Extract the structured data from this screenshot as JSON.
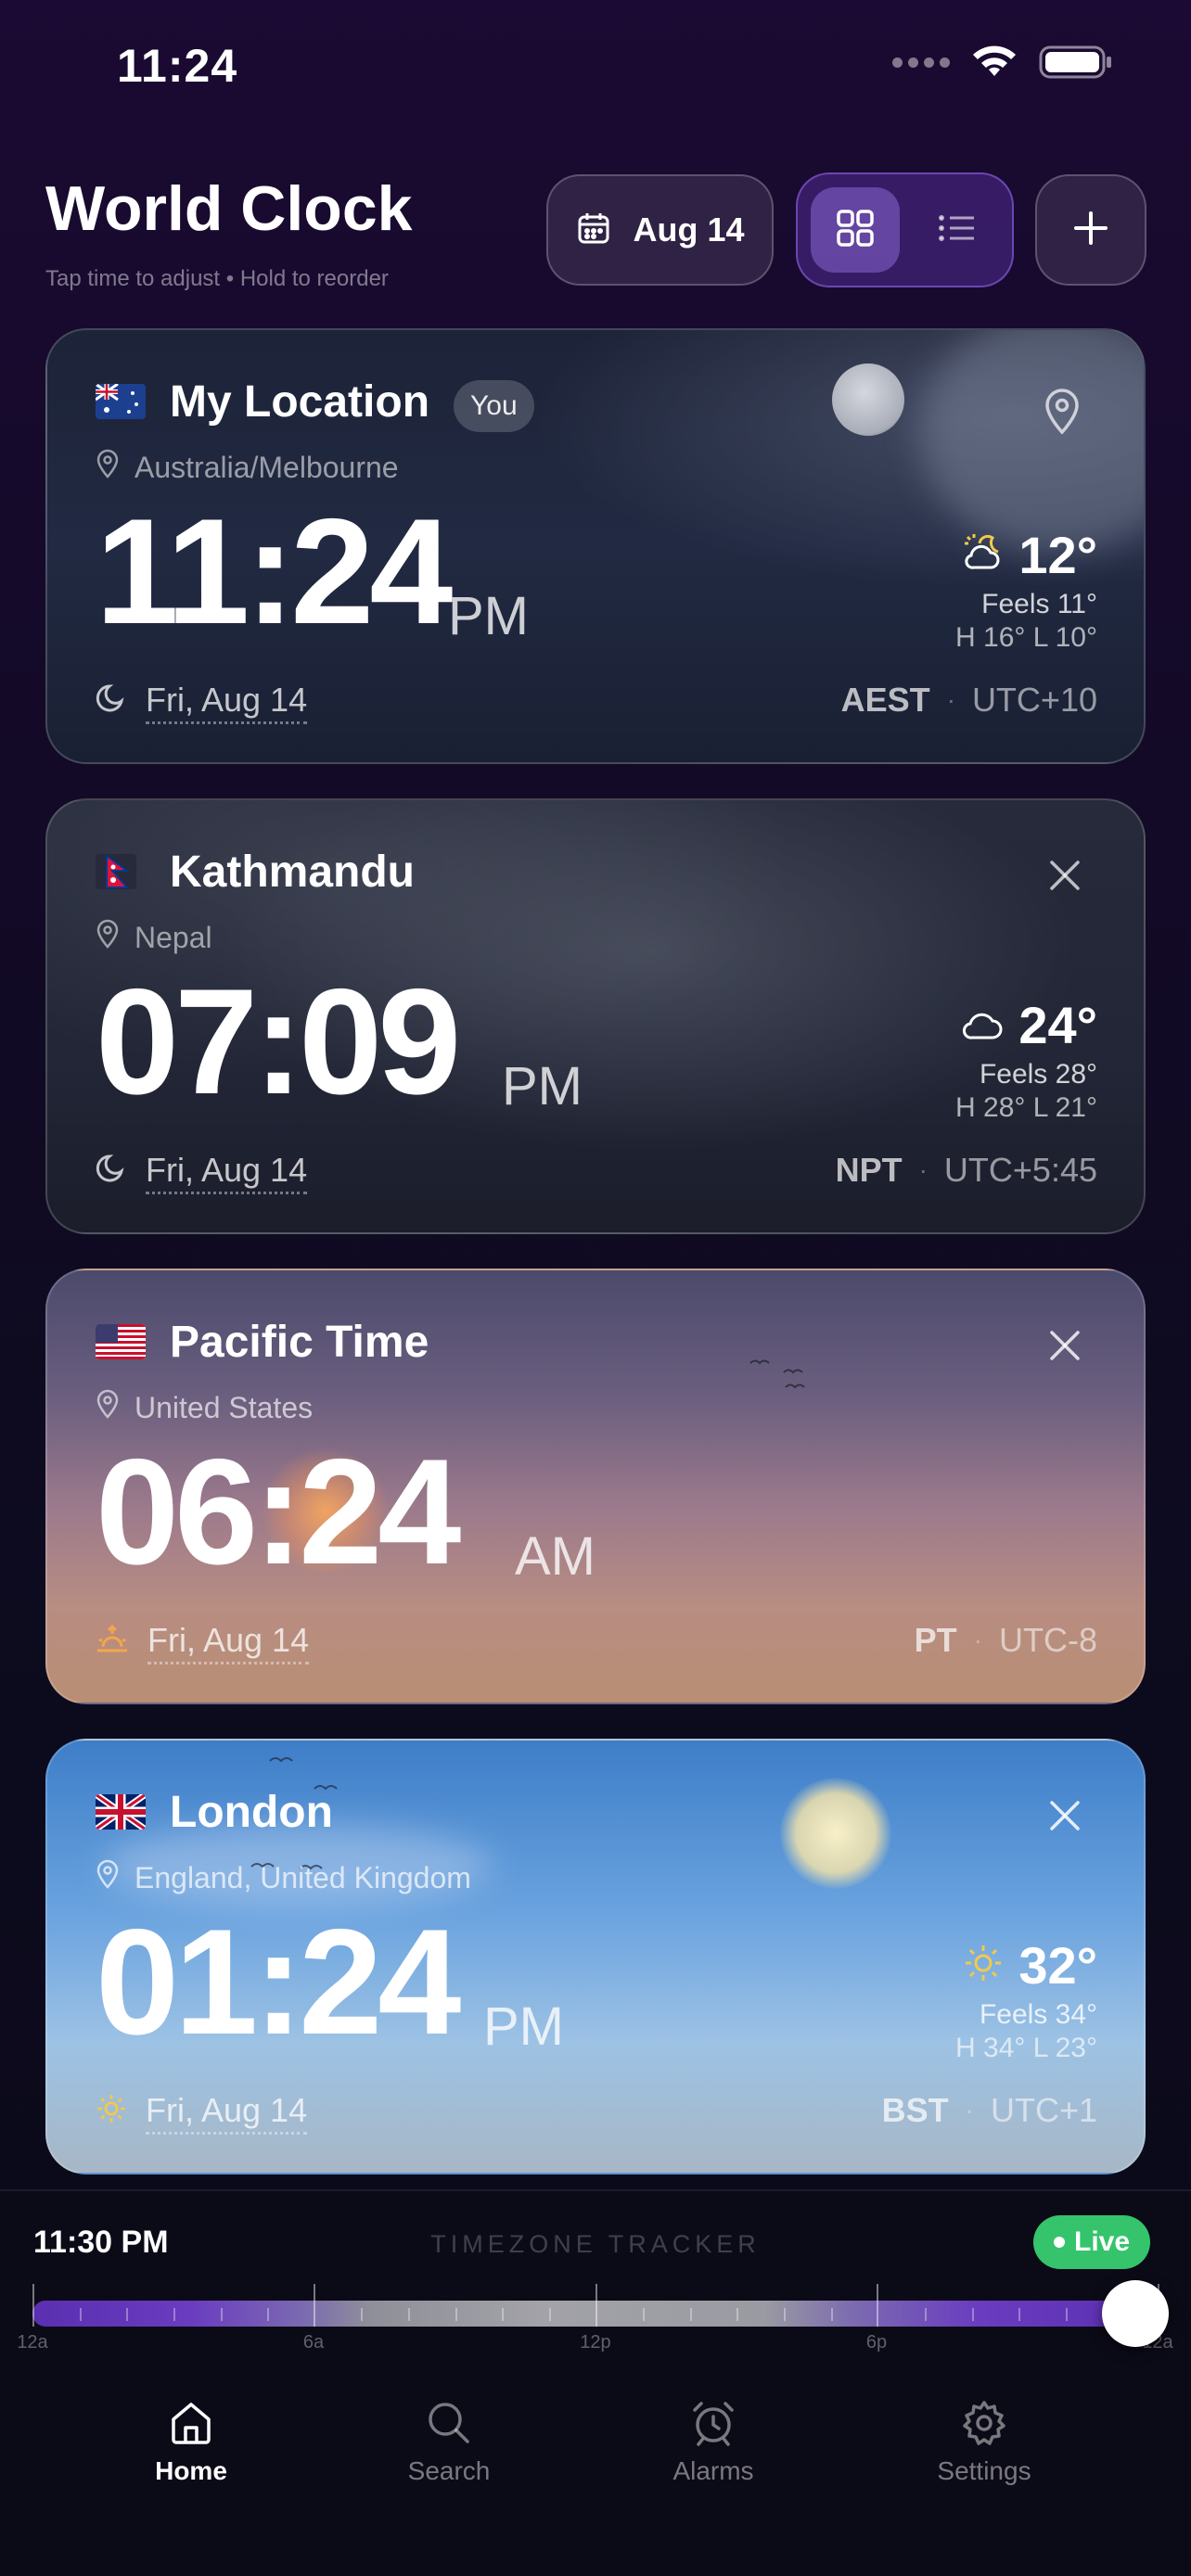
{
  "status_bar": {
    "time": "11:24"
  },
  "header": {
    "title": "World Clock",
    "subtitle": "Tap time to adjust • Hold to reorder",
    "date_button": "Aug 14",
    "add_button": "+"
  },
  "cards": [
    {
      "name": "My Location",
      "badge": "You",
      "region": "Australia/Melbourne",
      "time": "11:24",
      "ampm": "PM",
      "temp": "12°",
      "feels": "Feels 11°",
      "hilo": "H 16° L 10°",
      "date": "Fri, Aug 14",
      "tz_abbr": "AEST",
      "utc": "UTC+10",
      "weather_icon": "partly-cloudy-night-icon",
      "day_icon": "moon-icon",
      "action_icon": "location-pin-icon"
    },
    {
      "name": "Kathmandu",
      "region": "Nepal",
      "time": "07:09",
      "ampm": "PM",
      "temp": "24°",
      "feels": "Feels 28°",
      "hilo": "H 28° L 21°",
      "date": "Fri, Aug 14",
      "tz_abbr": "NPT",
      "utc": "UTC+5:45",
      "weather_icon": "cloud-icon",
      "day_icon": "moon-icon",
      "action_icon": "close-icon"
    },
    {
      "name": "Pacific Time",
      "region": "United States",
      "time": "06:24",
      "ampm": "AM",
      "date": "Fri, Aug 14",
      "tz_abbr": "PT",
      "utc": "UTC-8",
      "day_icon": "sunrise-icon",
      "action_icon": "close-icon"
    },
    {
      "name": "London",
      "region": "England, United Kingdom",
      "time": "01:24",
      "ampm": "PM",
      "temp": "32°",
      "feels": "Feels 34°",
      "hilo": "H 34° L 23°",
      "date": "Fri, Aug 14",
      "tz_abbr": "BST",
      "utc": "UTC+1",
      "weather_icon": "sun-icon",
      "day_icon": "sun-icon",
      "action_icon": "close-icon"
    }
  ],
  "tracker": {
    "time": "11:30 PM",
    "title": "TIMEZONE TRACKER",
    "live": "Live",
    "labels": [
      "12a",
      "6a",
      "12p",
      "6p",
      "12a"
    ],
    "position_fraction": 0.979
  },
  "nav": [
    {
      "label": "Home",
      "icon": "home-icon",
      "active": true
    },
    {
      "label": "Search",
      "icon": "search-icon",
      "active": false
    },
    {
      "label": "Alarms",
      "icon": "alarm-icon",
      "active": false
    },
    {
      "label": "Settings",
      "icon": "gear-icon",
      "active": false
    }
  ],
  "colors": {
    "accent": "#6a3cc0",
    "live": "#35c46b",
    "sun": "#f2c94c"
  }
}
